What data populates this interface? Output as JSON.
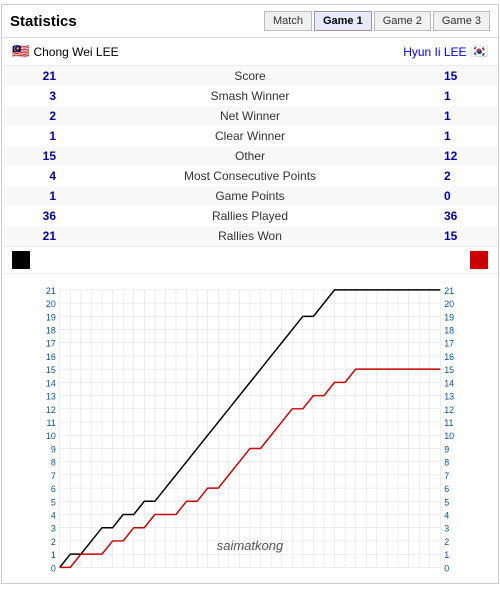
{
  "header": {
    "title": "Statistics",
    "tabs": [
      "Match",
      "Game 1",
      "Game 2",
      "Game 3"
    ],
    "active_tab": "Game 1"
  },
  "players": {
    "left": "Chong Wei LEE",
    "right": "Hyun Ii LEE",
    "left_flag": "🇲🇾",
    "right_flag": "🇰🇷"
  },
  "stats": [
    {
      "left": "21",
      "label": "Score",
      "right": "15"
    },
    {
      "left": "3",
      "label": "Smash Winner",
      "right": "1"
    },
    {
      "left": "2",
      "label": "Net Winner",
      "right": "1"
    },
    {
      "left": "1",
      "label": "Clear Winner",
      "right": "1"
    },
    {
      "left": "15",
      "label": "Other",
      "right": "12"
    },
    {
      "left": "4",
      "label": "Most Consecutive Points",
      "right": "2"
    },
    {
      "left": "1",
      "label": "Game Points",
      "right": "0"
    },
    {
      "left": "36",
      "label": "Rallies Played",
      "right": "36"
    },
    {
      "left": "21",
      "label": "Rallies Won",
      "right": "15"
    }
  ],
  "chart": {
    "black_points": [
      [
        0,
        0
      ],
      [
        1,
        1
      ],
      [
        2,
        1
      ],
      [
        3,
        2
      ],
      [
        4,
        3
      ],
      [
        5,
        3
      ],
      [
        6,
        4
      ],
      [
        7,
        4
      ],
      [
        8,
        5
      ],
      [
        9,
        5
      ],
      [
        10,
        6
      ],
      [
        11,
        7
      ],
      [
        12,
        8
      ],
      [
        13,
        9
      ],
      [
        14,
        10
      ],
      [
        15,
        11
      ],
      [
        16,
        12
      ],
      [
        17,
        13
      ],
      [
        18,
        14
      ],
      [
        19,
        15
      ],
      [
        20,
        16
      ],
      [
        21,
        17
      ],
      [
        22,
        18
      ],
      [
        23,
        19
      ],
      [
        24,
        19
      ],
      [
        25,
        20
      ],
      [
        26,
        21
      ],
      [
        27,
        21
      ],
      [
        28,
        21
      ],
      [
        29,
        21
      ],
      [
        30,
        21
      ],
      [
        31,
        21
      ],
      [
        32,
        21
      ],
      [
        33,
        21
      ],
      [
        34,
        21
      ],
      [
        35,
        21
      ],
      [
        36,
        21
      ]
    ],
    "red_points": [
      [
        0,
        0
      ],
      [
        1,
        0
      ],
      [
        2,
        1
      ],
      [
        3,
        1
      ],
      [
        4,
        1
      ],
      [
        5,
        2
      ],
      [
        6,
        2
      ],
      [
        7,
        3
      ],
      [
        8,
        3
      ],
      [
        9,
        4
      ],
      [
        10,
        4
      ],
      [
        11,
        4
      ],
      [
        12,
        5
      ],
      [
        13,
        5
      ],
      [
        14,
        6
      ],
      [
        15,
        6
      ],
      [
        16,
        7
      ],
      [
        17,
        8
      ],
      [
        18,
        9
      ],
      [
        19,
        9
      ],
      [
        20,
        10
      ],
      [
        21,
        11
      ],
      [
        22,
        12
      ],
      [
        23,
        12
      ],
      [
        24,
        13
      ],
      [
        25,
        13
      ],
      [
        26,
        14
      ],
      [
        27,
        14
      ],
      [
        28,
        15
      ],
      [
        29,
        15
      ],
      [
        30,
        15
      ],
      [
        31,
        15
      ],
      [
        32,
        15
      ],
      [
        33,
        15
      ],
      [
        34,
        15
      ],
      [
        35,
        15
      ],
      [
        36,
        15
      ]
    ],
    "max_x": 36,
    "max_y": 21,
    "watermark": "saimatkong"
  }
}
